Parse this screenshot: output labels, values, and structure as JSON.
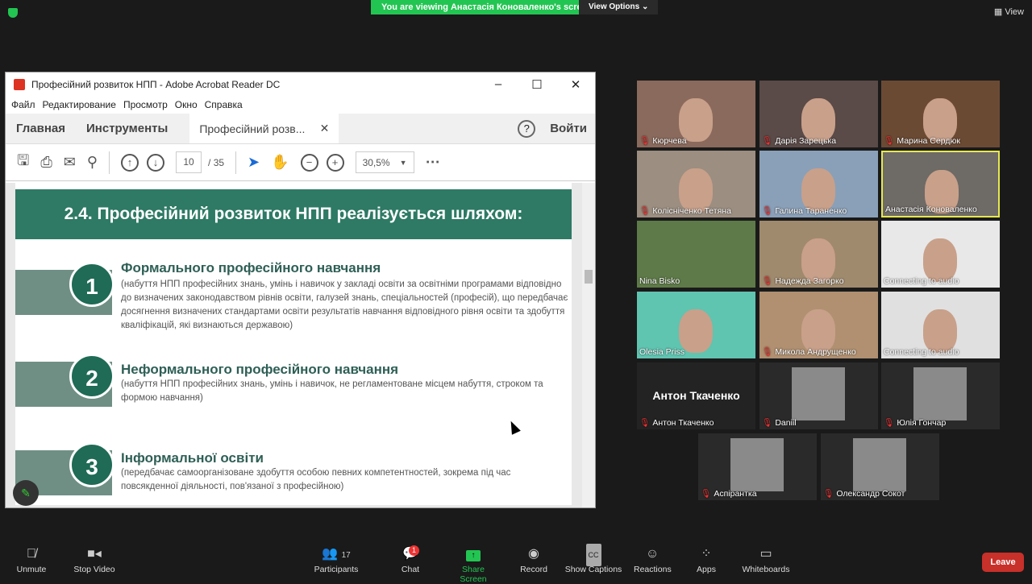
{
  "zoom": {
    "banner": "You are viewing Анастасія Коноваленко's screen",
    "view_options": "View Options",
    "view": "View"
  },
  "acrobat": {
    "title": "Професійний розвиток НПП - Adobe Acrobat Reader DC",
    "menu": [
      "Файл",
      "Редактирование",
      "Просмотр",
      "Окно",
      "Справка"
    ],
    "tabs": {
      "home": "Главная",
      "tools": "Инструменты",
      "doc": "Професійний розв...",
      "login": "Войти"
    },
    "page_current": "10",
    "page_total": "/ 35",
    "zoom_level": "30,5%"
  },
  "slide": {
    "heading": "2.4. Професійний розвиток НПП реалізується шляхом:",
    "items": [
      {
        "num": "1",
        "title": "Формального професійного навчання",
        "desc": "(набуття НПП професійних знань, умінь і навичок у закладі освіти за освітніми програмами відповідно до визначених законодавством рівнів освіти, галузей знань, спеціальностей (професій), що передбачає досягнення визначених стандартами освіти результатів навчання відповідного рівня освіти та здобуття кваліфікацій, які визнаються державою)"
      },
      {
        "num": "2",
        "title": "Неформального професійного навчання",
        "desc": "(набуття НПП професійних знань, умінь і навичок, не регламентоване місцем набуття, строком та формою навчання)"
      },
      {
        "num": "3",
        "title": "Інформальної освіти",
        "desc": "(передбачає самоорганізоване здобуття особою певних компетентностей, зокрема під час повсякденної діяльності, пов'язаної з професійною)"
      }
    ]
  },
  "participants": [
    {
      "name": "Кюрчева",
      "muted": true
    },
    {
      "name": "Дарія Зарецька",
      "muted": true
    },
    {
      "name": "Марина Сердюк",
      "muted": true
    },
    {
      "name": "Колісніченко Тетяна",
      "muted": true
    },
    {
      "name": "Галина Тараненко",
      "muted": true
    },
    {
      "name": "Анастасія Коноваленко",
      "muted": false,
      "active": true
    },
    {
      "name": "Nina Bisko",
      "muted": false
    },
    {
      "name": "Надежда Загорко",
      "muted": true
    },
    {
      "name": "Connecting to audio",
      "muted": false
    },
    {
      "name": "Olesia Priss",
      "muted": false
    },
    {
      "name": "Микола Андрущенко",
      "muted": true
    },
    {
      "name": "Connecting to audio",
      "muted": false
    },
    {
      "name": "Антон Ткаченко",
      "muted": true,
      "big": "Антон Ткаченко"
    },
    {
      "name": "Daniil",
      "muted": true
    },
    {
      "name": "Юлія Гончар",
      "muted": true
    },
    {
      "name": "Аспірантка",
      "muted": true
    },
    {
      "name": "Олександр Сокот",
      "muted": true
    }
  ],
  "toolbar": {
    "unmute": "Unmute",
    "stop_video": "Stop Video",
    "participants": "Participants",
    "participants_count": "17",
    "chat": "Chat",
    "chat_badge": "1",
    "share": "Share Screen",
    "record": "Record",
    "captions": "Show Captions",
    "reactions": "Reactions",
    "apps": "Apps",
    "whiteboards": "Whiteboards",
    "leave": "Leave"
  },
  "colors": {
    "share_green": "#23c552",
    "leave_red": "#c8302a",
    "slide_green": "#2e7a64",
    "active_border": "#e6e94e"
  }
}
